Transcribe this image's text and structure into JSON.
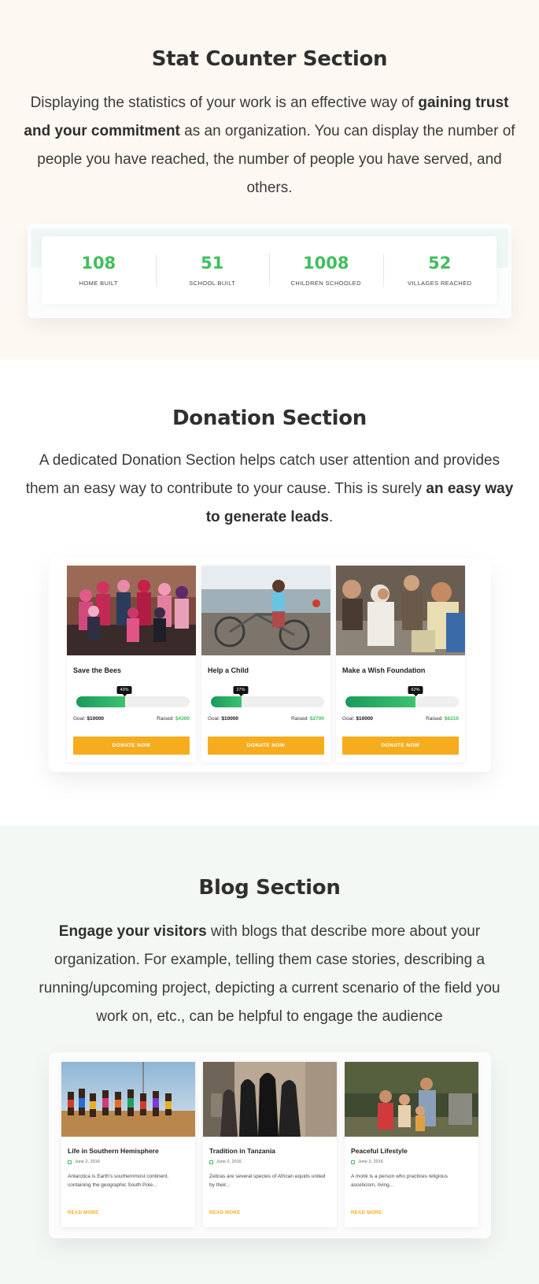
{
  "stat_section": {
    "title": "Stat Counter Section",
    "text_1": "Displaying the statistics of your work is an effective way of ",
    "text_bold": "gaining trust and your commitment",
    "text_2": " as an organization. You can display the number of people you have reached, the number of people you have served, and others.",
    "stats": [
      {
        "value": "108",
        "label": "HOME BUILT"
      },
      {
        "value": "51",
        "label": "SCHOOL BUILT"
      },
      {
        "value": "1008",
        "label": "CHILDREN SCHOOLED"
      },
      {
        "value": "52",
        "label": "VILLAGES REACHED"
      }
    ],
    "colors": {
      "background": "#fdf8f2",
      "number": "#3fbf5c"
    }
  },
  "donation_section": {
    "title": "Donation Section",
    "text_1": "A dedicated Donation Section helps catch user attention and provides them an easy way to contribute to your cause. This is surely ",
    "text_bold": "an easy way to generate leads",
    "text_2": ".",
    "cards": [
      {
        "title": "Save the Bees",
        "progress_label": "43%",
        "progress": 0.43,
        "goal_label": "Goal:",
        "goal": "$10000",
        "raised_label": "Raised:",
        "raised": "$4300",
        "button": "DONATE NOW"
      },
      {
        "title": "Help a Child",
        "progress_label": "27%",
        "progress": 0.27,
        "goal_label": "Goal:",
        "goal": "$10000",
        "raised_label": "Raised:",
        "raised": "$2700",
        "button": "DONATE NOW"
      },
      {
        "title": "Make a Wish Foundation",
        "progress_label": "62%",
        "progress": 0.62,
        "goal_label": "Goal:",
        "goal": "$10000",
        "raised_label": "Raised:",
        "raised": "$6210",
        "button": "DONATE NOW"
      }
    ],
    "colors": {
      "button": "#f5ad1d",
      "progress": "#1a9a5c",
      "raised": "#3fbf5c"
    }
  },
  "blog_section": {
    "title": "Blog Section",
    "text_bold": "Engage your visitors",
    "text_1": " with blogs that describe more about your organization. For example, telling them case stories, describing a running/upcoming project, depicting a current scenario of the field you work on, etc., can be helpful to engage the audience",
    "posts": [
      {
        "title": "Life in Southern Hemisphere",
        "date": "June 2, 2016",
        "excerpt": "Antarctica is Earth's southernmost continent, containing the geographic South Pole...",
        "read_more": "READ MORE"
      },
      {
        "title": "Tradition in Tanzania",
        "date": "June 2, 2016",
        "excerpt": "Zebras are several species of African equids united by their...",
        "read_more": "READ MORE"
      },
      {
        "title": "Peaceful Lifestyle",
        "date": "June 2, 2016",
        "excerpt": "A monk is a person who practices religious asceticism, living...",
        "read_more": "READ MORE"
      }
    ],
    "colors": {
      "background": "#f4f8f4",
      "read_more": "#f5ad1d"
    }
  }
}
